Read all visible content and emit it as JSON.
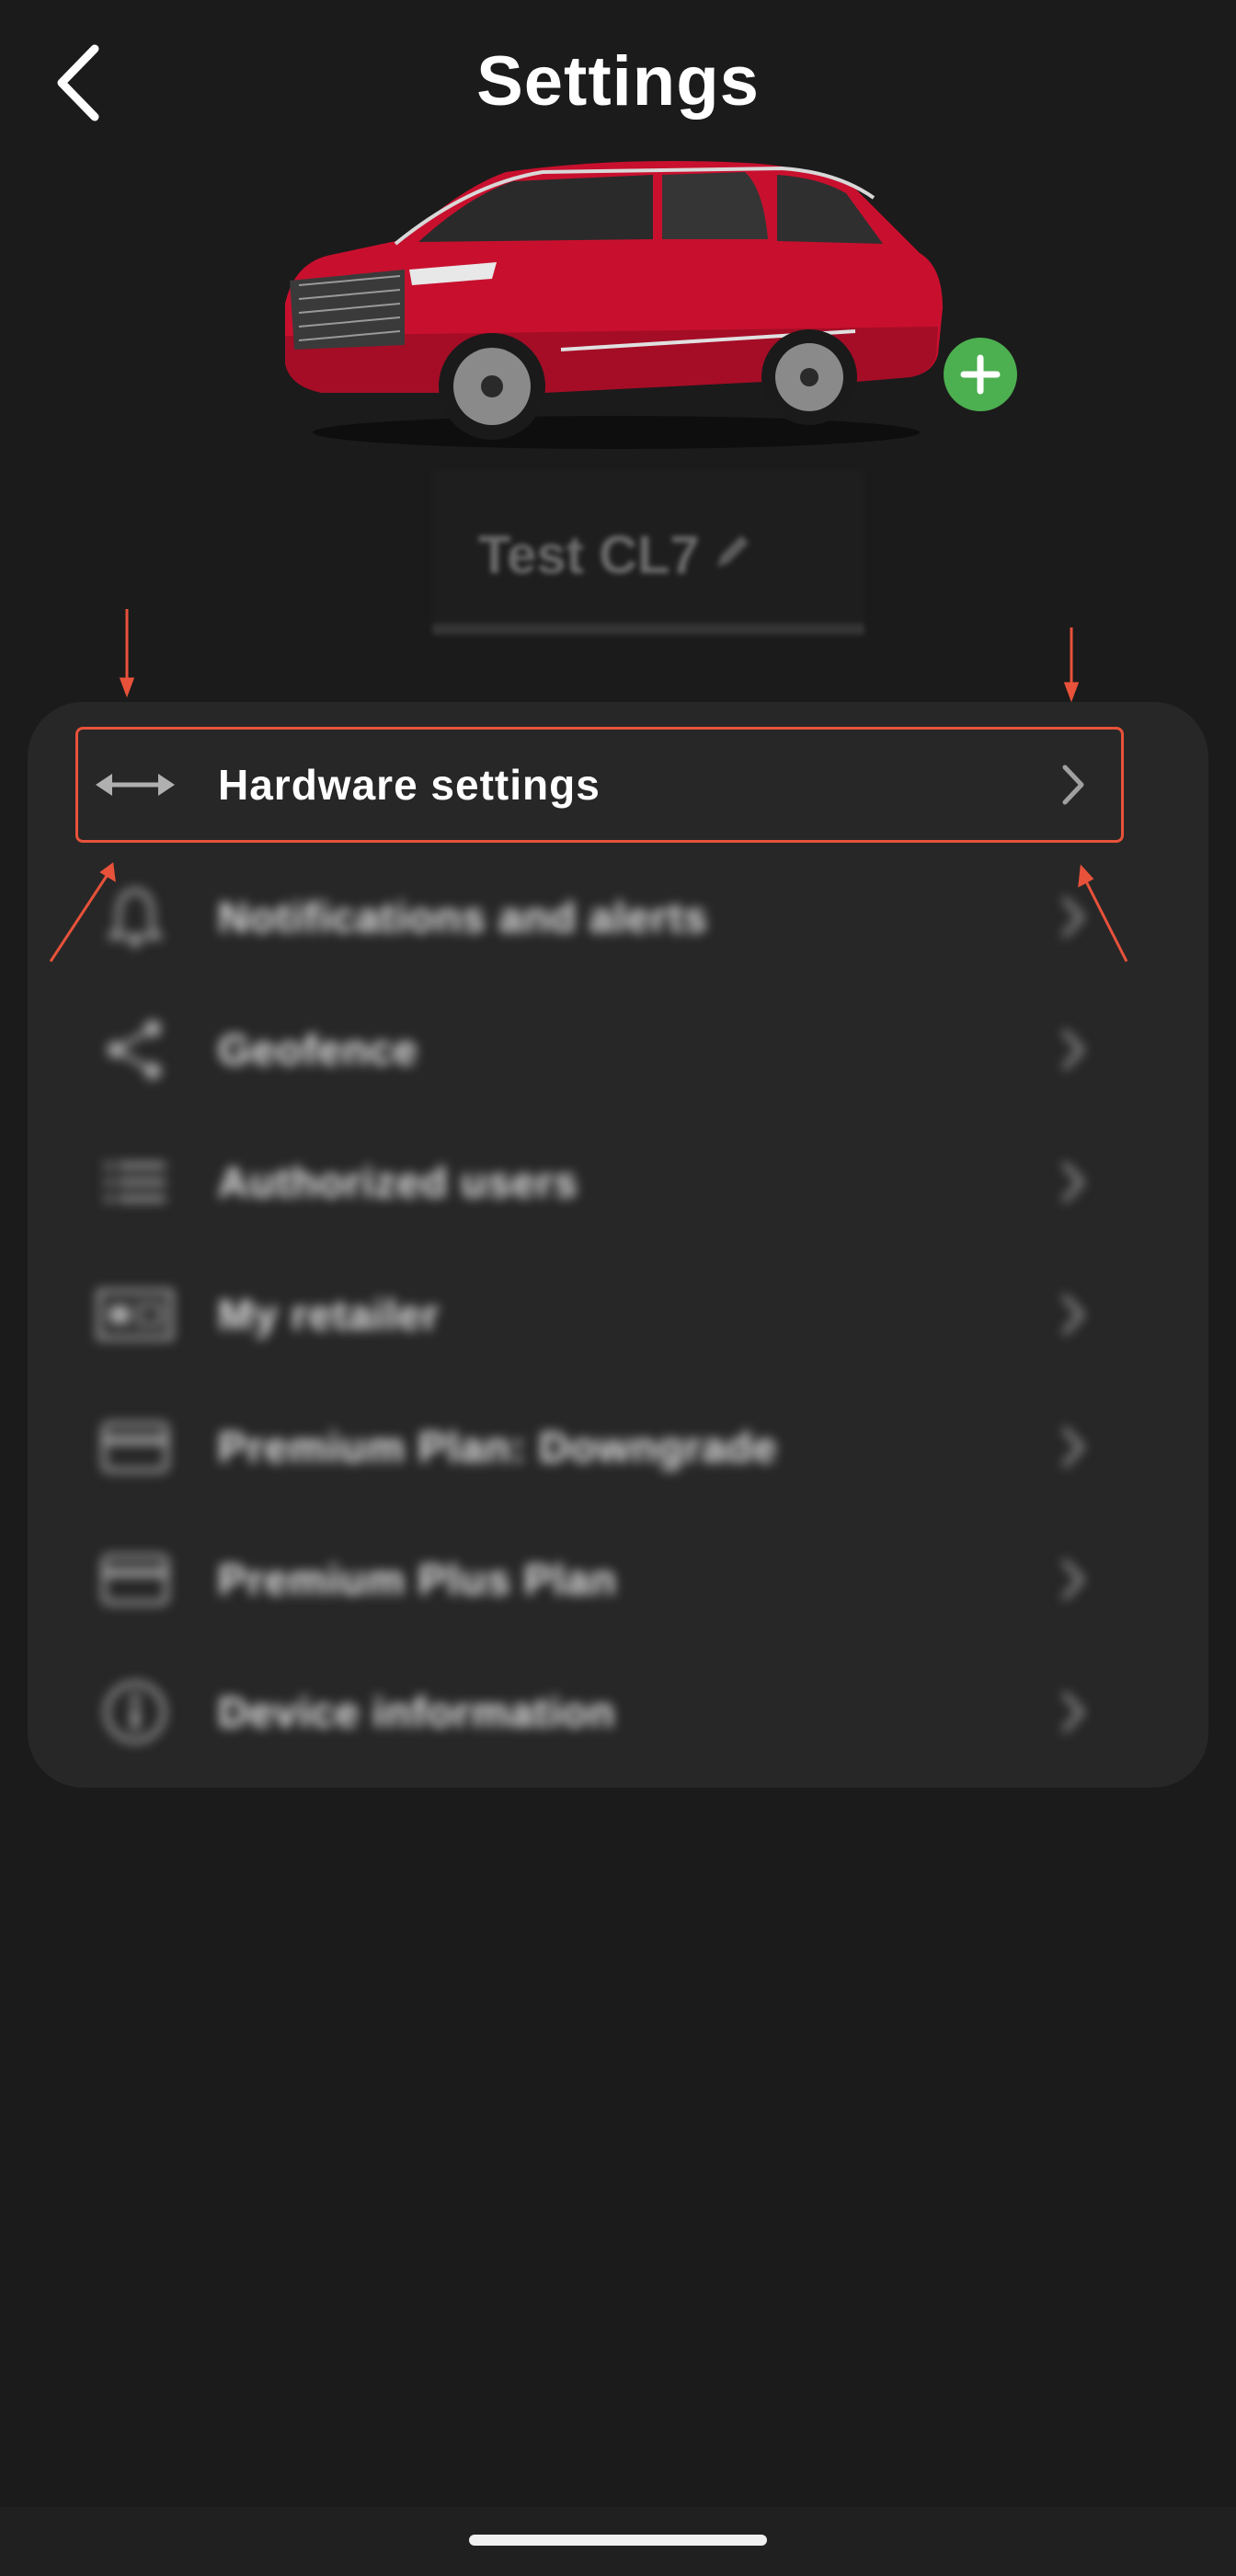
{
  "header": {
    "title": "Settings",
    "back_icon": "chevron-left-icon"
  },
  "vehicle": {
    "name": "Test CL7",
    "body_color": "#c8102e",
    "add_icon": "plus-icon",
    "add_color": "#4caf50"
  },
  "menu": {
    "items": [
      {
        "label": "Hardware settings",
        "icon": "horizontal-double-arrow-icon"
      },
      {
        "label": "Notifications and alerts",
        "icon": "bell-icon"
      },
      {
        "label": "Geofence",
        "icon": "share-nodes-icon"
      },
      {
        "label": "Authorized users",
        "icon": "list-icon"
      },
      {
        "label": "My retailer",
        "icon": "storefront-icon"
      },
      {
        "label": "Premium Plan: Downgrade",
        "icon": "credit-card-icon"
      },
      {
        "label": "Premium Plus Plan",
        "icon": "credit-card-icon"
      },
      {
        "label": "Device information",
        "icon": "info-circle-icon"
      }
    ]
  },
  "annotation": {
    "highlight_color": "#e8523a",
    "highlighted_item": "Hardware settings"
  }
}
